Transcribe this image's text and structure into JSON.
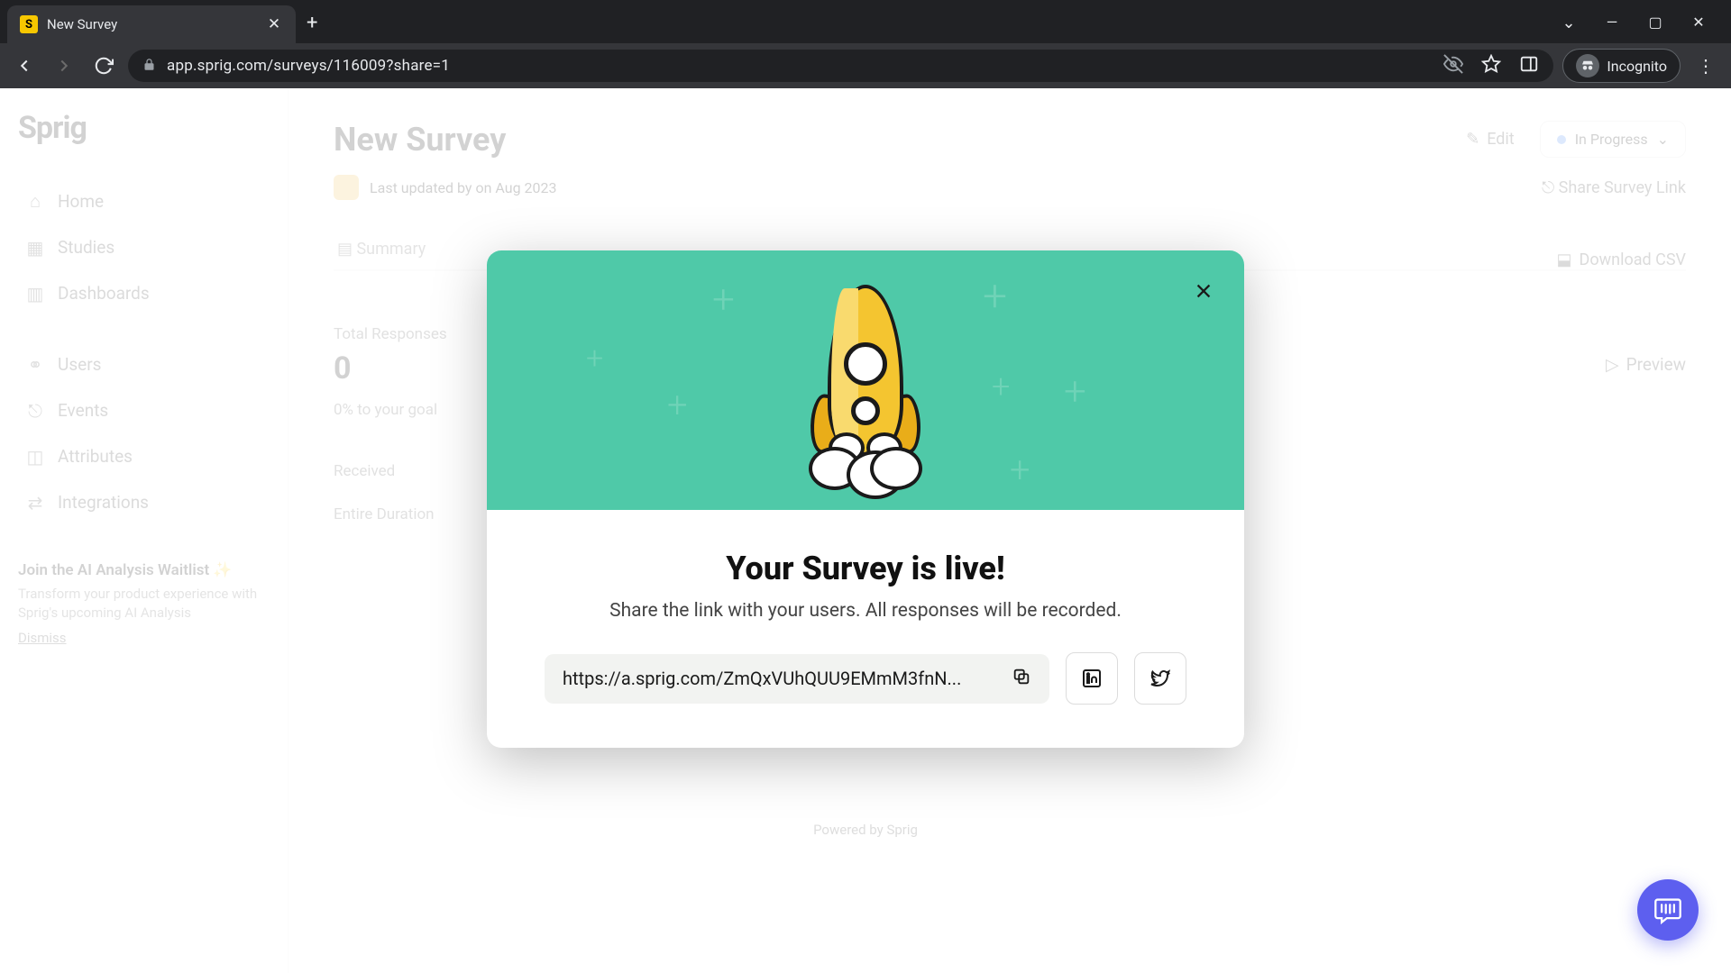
{
  "browser": {
    "tab_title": "New Survey",
    "favicon_letter": "S",
    "url_display": "app.sprig.com/surveys/116009?share=1",
    "incognito_label": "Incognito"
  },
  "sidebar": {
    "logo": "Sprig",
    "nav": [
      {
        "label": "Home",
        "icon": "⌂"
      },
      {
        "label": "Studies",
        "icon": "▦"
      },
      {
        "label": "Dashboards",
        "icon": "▥"
      },
      {
        "label": "Users",
        "icon": "⚭"
      },
      {
        "label": "Events",
        "icon": "⎋"
      },
      {
        "label": "Attributes",
        "icon": "◫"
      },
      {
        "label": "Integrations",
        "icon": "⇄"
      }
    ],
    "ai": {
      "title": "Join the AI Analysis Waitlist ✨",
      "desc": "Transform your product experience with Sprig's upcoming AI Analysis",
      "dismiss": "Dismiss"
    }
  },
  "main": {
    "title": "New Survey",
    "subtitle": "Last updated by on Aug 2023",
    "summary_tab": "Summary",
    "edit": "Edit",
    "status": "In Progress",
    "share_link": "Share Survey Link",
    "download_csv": "Download CSV",
    "preview": "Preview",
    "total_responses_label": "Total Responses",
    "total_responses_value": "0",
    "goal_note": "0% to your goal",
    "received_label": "Received",
    "duration_label": "Entire Duration",
    "powered": "Powered by Sprig"
  },
  "modal": {
    "title": "Your Survey is live!",
    "text": "Share the link with your users. All responses will be recorded.",
    "link": "https://a.sprig.com/ZmQxVUhQUU9EMmM3fnN..."
  }
}
